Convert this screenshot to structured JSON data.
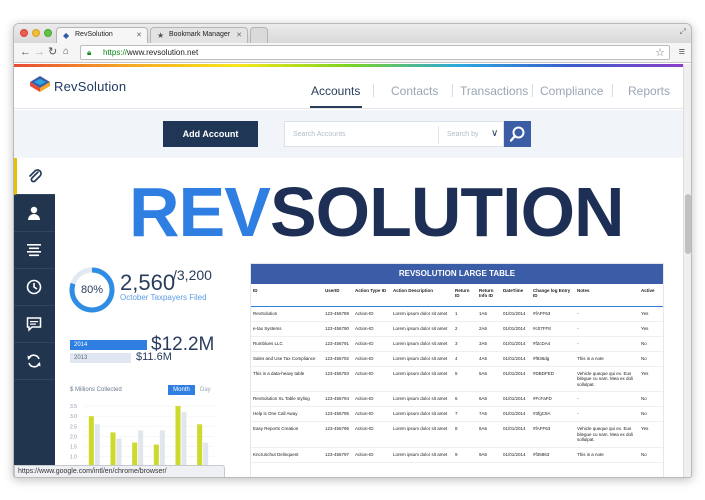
{
  "browser": {
    "tabs": [
      {
        "title": "RevSolution"
      },
      {
        "title": "Bookmark Manager"
      }
    ],
    "url_scheme": "https://",
    "url_rest": "www.revsolution.net",
    "status_url": "https://www.google.com/intl/en/chrome/browser/"
  },
  "brand": {
    "name": "RevSolution",
    "hero_left": "REV",
    "hero_right": "SOLUTION"
  },
  "nav": {
    "items": [
      "Accounts",
      "Contacts",
      "Transactions",
      "Compliance",
      "Reports"
    ],
    "active": "Accounts"
  },
  "actions": {
    "add_account": "Add Account",
    "search_placeholder": "Search Accounts",
    "search_by": "Search by"
  },
  "sidebar": {
    "icons": [
      "paperclip-icon",
      "user-icon",
      "align-center-icon",
      "clock-icon",
      "comment-icon",
      "refresh-icon"
    ],
    "active_index": 0
  },
  "stats": {
    "percent_label": "80%",
    "percent_value": 0.8,
    "count": "2,560",
    "total": "3,200",
    "caption": "October Taxpayers Filed",
    "year_a": "2014",
    "amount_a": "$12.2M",
    "year_b": "2013",
    "amount_b": "$11.6M"
  },
  "mini_chart": {
    "label": "$ Millions Collected",
    "toggle_active": "Month",
    "toggle_other": "Day"
  },
  "chart_data": {
    "type": "bar",
    "ytick_labels": [
      "3.5",
      "3.0",
      "2.5",
      "2.0",
      "1.5",
      "1.0"
    ],
    "series": [
      {
        "values": [
          3.0,
          2.2,
          1.7,
          1.6,
          3.5,
          2.6
        ]
      },
      {
        "values": [
          2.6,
          1.9,
          2.3,
          2.3,
          3.2,
          1.7
        ]
      }
    ],
    "ylim": [
      0,
      3.8
    ],
    "colors": [
      "#cdd92b",
      "#e1e6ee"
    ]
  },
  "table": {
    "title": "REVSOLUTION LARGE TABLE",
    "columns": [
      "ID",
      "UserID",
      "Action Type ID",
      "Action Description",
      "Return ID",
      "Return Info ID",
      "DateTime",
      "Change log Entry ID",
      "Notes",
      "Active"
    ],
    "rows": [
      [
        "RevSolution",
        "123-456789",
        "Action-ID",
        "Lorem ipsum dolor sit amet",
        "1",
        "1A6",
        "01/01/2014",
        "#fAFF63",
        "-",
        "Yes"
      ],
      [
        "e-tax Systems",
        "123-456790",
        "Action-ID",
        "Lorem ipsum dolor sit amet",
        "2",
        "2A6",
        "01/01/2014",
        "#c07FF8",
        "-",
        "Yes"
      ],
      [
        "Rumblues LLC",
        "123-456791",
        "Action-ID",
        "Lorem ipsum dolor sit amet",
        "3",
        "3A6",
        "01/01/2014",
        "#f2cDA4",
        "-",
        "No"
      ],
      [
        "Sales and Use Tax Compliance",
        "123-456792",
        "Action-ID",
        "Lorem ipsum dolor sit amet",
        "4",
        "4A6",
        "01/01/2014",
        "#f936dg",
        "This is a note",
        "No"
      ],
      [
        "This is a data-heavy table",
        "123-456793",
        "Action-ID",
        "Lorem ipsum dolor sit amet",
        "5",
        "5A6",
        "01/01/2014",
        "#DBDFED",
        "Vehicle queque qui ex. Eus bilegue cu nam. Mea ex doli sollulpat.",
        "Yes"
      ],
      [
        "RevSolution XL Table styling",
        "123-456794",
        "Action-ID",
        "Lorem ipsum dolor sit amet",
        "6",
        "6A6",
        "01/01/2014",
        "#FcFaFD",
        "-",
        "No"
      ],
      [
        "Help is One Call Away",
        "123-456795",
        "Action-ID",
        "Lorem ipsum dolor sit amet",
        "7",
        "7A6",
        "01/01/2014",
        "#3fgC9A",
        "-",
        "No"
      ],
      [
        "Easy Reports Creation",
        "123-456796",
        "Action-ID",
        "Lorem ipsum dolor sit amet",
        "8",
        "8A6",
        "01/01/2014",
        "#fAFF63",
        "Vehicle queque qui ex. Eus bilegue cu nam. Mea ex doli sollulpat.",
        "Yes"
      ],
      [
        "Kncrunchut Delinquent",
        "123-456797",
        "Action-ID",
        "Lorem ipsum dolor sit amet",
        "9",
        "9A6",
        "01/01/2014",
        "#f35863",
        "This is a note",
        "No"
      ]
    ]
  }
}
